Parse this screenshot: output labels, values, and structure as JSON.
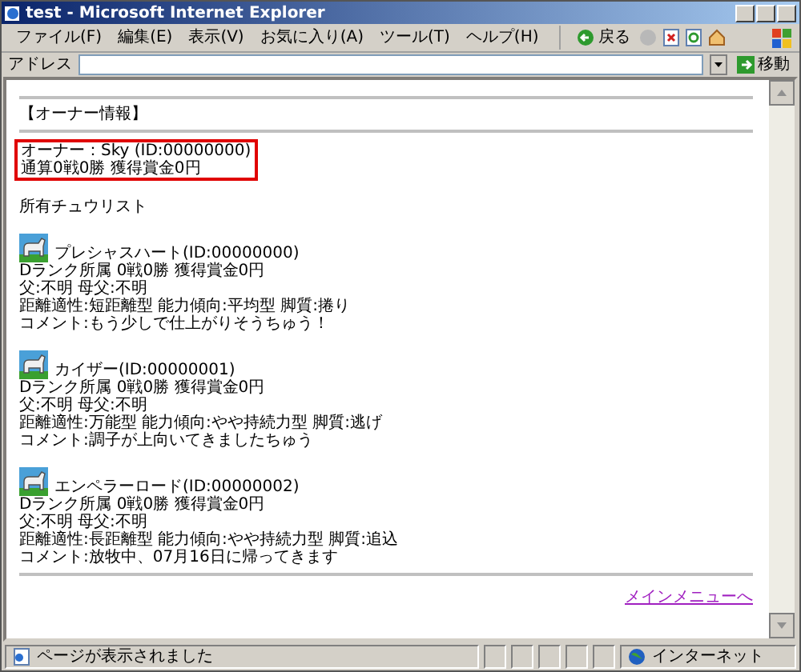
{
  "window": {
    "title": "test - Microsoft Internet Explorer"
  },
  "menu": [
    "ファイル(F)",
    "編集(E)",
    "表示(V)",
    "お気に入り(A)",
    "ツール(T)",
    "ヘルプ(H)"
  ],
  "toolbar": {
    "back_label": "戻る"
  },
  "address_bar": {
    "label": "アドレス",
    "go_label": "移動"
  },
  "content": {
    "heading": "【オーナー情報】",
    "owner_lines": [
      "オーナー：Sky (ID:00000000)",
      "通算0戦0勝 獲得賞金0円"
    ],
    "section_title": "所有チュウリスト",
    "horses": [
      {
        "name": "プレシャスハート(ID:00000000)",
        "lines": [
          "Dランク所属 0戦0勝 獲得賞金0円",
          "父:不明 母父:不明",
          "距離適性:短距離型 能力傾向:平均型 脚質:捲り",
          "コメント:もう少しで仕上がりそうちゅう！"
        ]
      },
      {
        "name": "カイザー(ID:00000001)",
        "lines": [
          "Dランク所属 0戦0勝 獲得賞金0円",
          "父:不明 母父:不明",
          "距離適性:万能型 能力傾向:やや持続力型 脚質:逃げ",
          "コメント:調子が上向いてきましたちゅう"
        ]
      },
      {
        "name": "エンペラーロード(ID:00000002)",
        "lines": [
          "Dランク所属 0戦0勝 獲得賞金0円",
          "父:不明 母父:不明",
          "距離適性:長距離型 能力傾向:やや持続力型 脚質:追込",
          "コメント:放牧中、07月16日に帰ってきます"
        ]
      }
    ],
    "link": "メインメニューへ"
  },
  "status_bar": {
    "text": "ページが表示されました",
    "zone": "インターネット"
  }
}
